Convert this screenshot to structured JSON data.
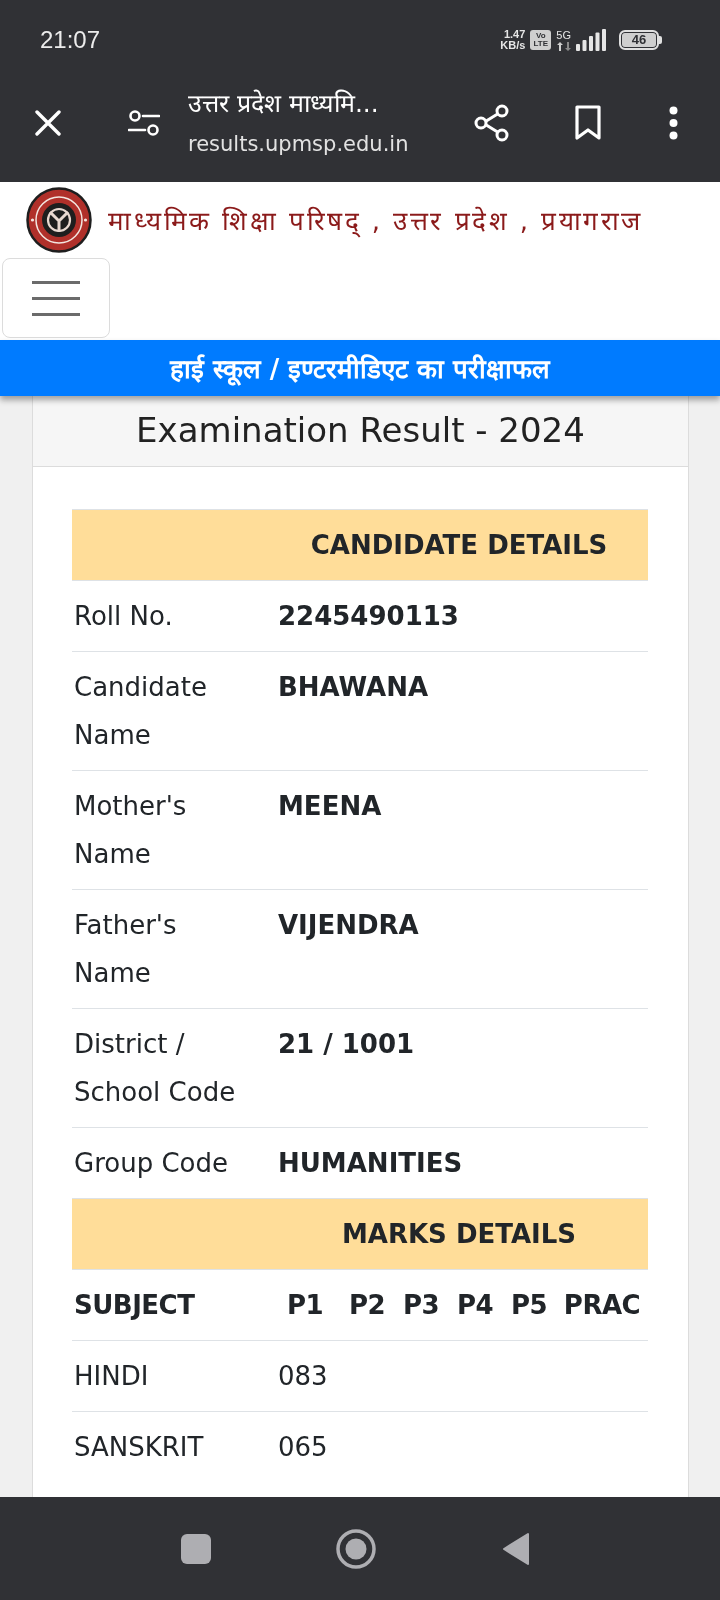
{
  "status_bar": {
    "time": "21:07",
    "speed_value": "1.47",
    "speed_unit": "KB/s",
    "volte": "Vo LTE",
    "network_type": "5G",
    "battery": "46"
  },
  "browser_bar": {
    "page_title": "उत्तर प्रदेश माध्यमि...",
    "url": "results.upmsp.edu.in"
  },
  "site_header": {
    "title": "माध्यमिक शिक्षा परिषद् , उत्तर प्रदेश , प्रयागराज"
  },
  "banner": {
    "title": "हाई स्कूल / इण्टरमीडिएट का परीक्षाफल"
  },
  "card": {
    "heading": "Examination Result - 2024",
    "candidate_details": {
      "title": "CANDIDATE DETAILS",
      "rows": [
        {
          "label": "Roll No.",
          "value": "2245490113"
        },
        {
          "label": "Candidate Name",
          "value": "BHAWANA"
        },
        {
          "label": "Mother's Name",
          "value": "MEENA"
        },
        {
          "label": "Father's Name",
          "value": "VIJENDRA"
        },
        {
          "label": "District / School Code",
          "value": "21 / 1001"
        },
        {
          "label": "Group Code",
          "value": "HUMANITIES"
        }
      ]
    },
    "marks_details": {
      "title": "MARKS DETAILS",
      "columns": [
        "SUBJECT",
        "P1",
        "P2",
        "P3",
        "P4",
        "P5",
        "PRAC"
      ],
      "rows": [
        {
          "cells": [
            "HINDI",
            "083"
          ]
        },
        {
          "cells": [
            "SANSKRIT",
            "065"
          ]
        }
      ]
    }
  }
}
